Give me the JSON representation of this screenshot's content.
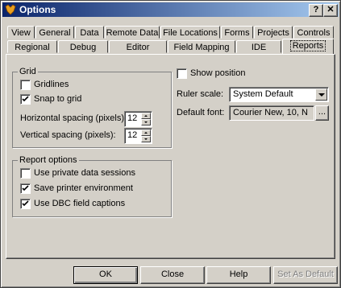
{
  "window": {
    "title": "Options",
    "help_glyph": "?",
    "close_glyph": "✕"
  },
  "tabs_row1": [
    {
      "label": "View"
    },
    {
      "label": "General"
    },
    {
      "label": "Data"
    },
    {
      "label": "Remote Data"
    },
    {
      "label": "File Locations"
    },
    {
      "label": "Forms"
    },
    {
      "label": "Projects"
    },
    {
      "label": "Controls"
    }
  ],
  "tabs_row2": [
    {
      "label": "Regional"
    },
    {
      "label": "Debug"
    },
    {
      "label": "Editor"
    },
    {
      "label": "Field Mapping"
    },
    {
      "label": "IDE"
    },
    {
      "label": "Reports"
    }
  ],
  "active_tab": "Reports",
  "grid": {
    "group_label": "Grid",
    "gridlines": {
      "label": "Gridlines",
      "checked": false
    },
    "snap": {
      "label": "Snap to grid",
      "checked": true
    },
    "horizontal": {
      "label": "Horizontal spacing (pixels):",
      "value": "12"
    },
    "vertical": {
      "label": "Vertical spacing (pixels):",
      "value": "12"
    }
  },
  "report_options": {
    "group_label": "Report options",
    "private": {
      "label": "Use private data sessions",
      "checked": false
    },
    "printer": {
      "label": "Save printer environment",
      "checked": true
    },
    "dbc": {
      "label": "Use DBC field captions",
      "checked": true
    }
  },
  "right": {
    "show_position": {
      "label": "Show position",
      "checked": false
    },
    "ruler_label": "Ruler scale:",
    "ruler_value": "System Default",
    "font_label": "Default font:",
    "font_value": "Courier New, 10, N",
    "font_btn": "..."
  },
  "buttons": {
    "ok": "OK",
    "close": "Close",
    "help": "Help",
    "set_default": "Set As Default"
  }
}
